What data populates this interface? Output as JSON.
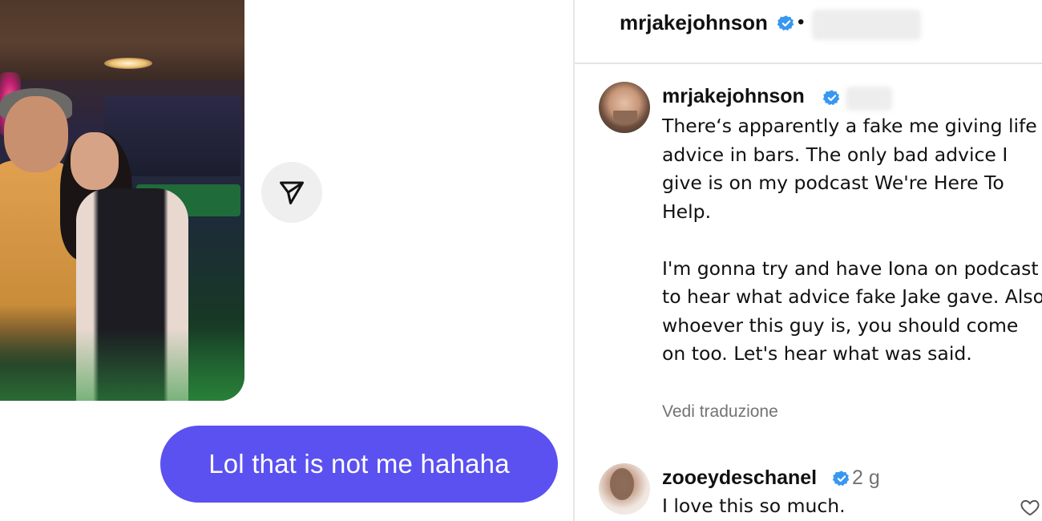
{
  "dm": {
    "message": "Lol that is not me hahaha",
    "share_icon": "send-icon"
  },
  "post": {
    "header": {
      "username": "mrjakejohnson",
      "separator": "•"
    },
    "caption": {
      "username": "mrjakejohnson",
      "text": "There‘s apparently a fake me giving life advice in bars. The only bad advice I give is on my podcast We're Here To Help.\n\nI'm gonna try and have Iona on podcast to hear what advice fake Jake gave. Also whoever this guy is, you should come on too. Let's hear what was said.",
      "translate_label": "Vedi traduzione"
    },
    "comment": {
      "username": "zooeydeschanel",
      "time": "2 g",
      "text": "I love this so much."
    }
  },
  "colors": {
    "bubble": "#5b51f0",
    "verified": "#3897f0",
    "muted": "#737373"
  }
}
